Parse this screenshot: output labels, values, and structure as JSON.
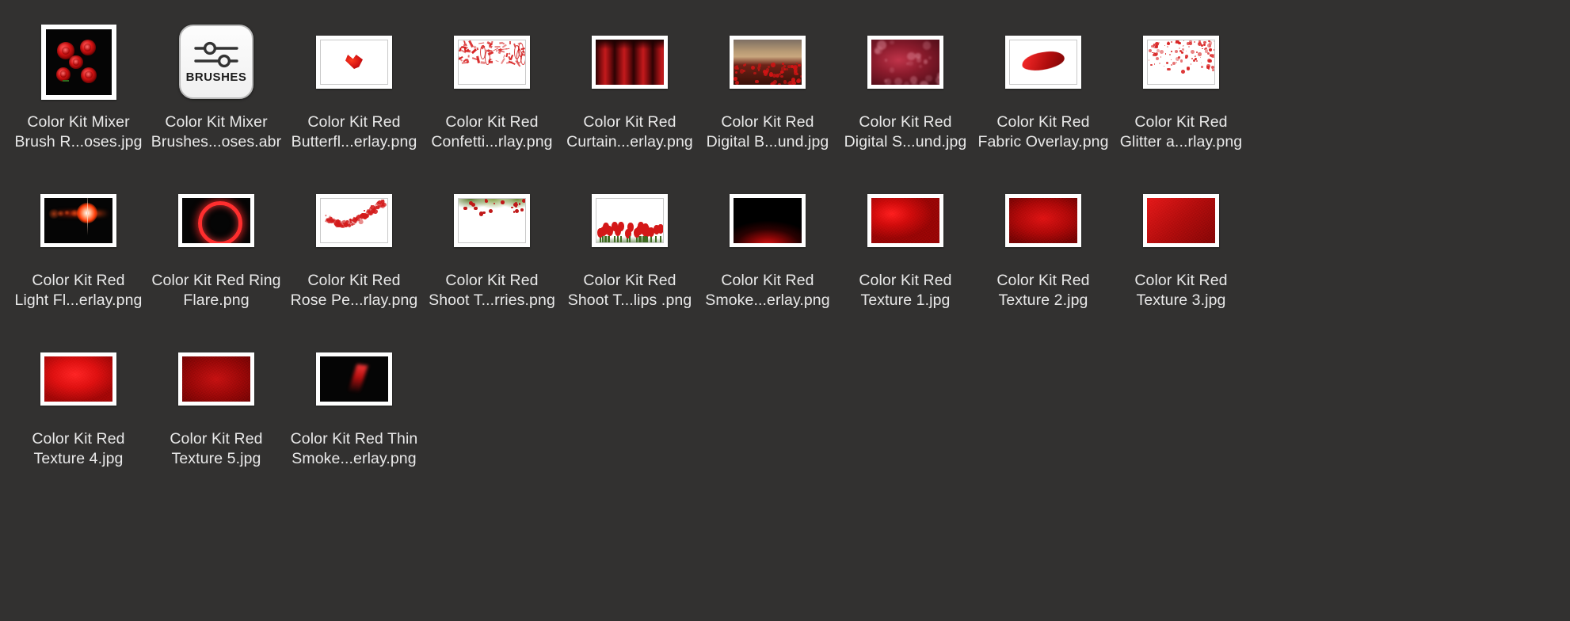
{
  "window": {
    "view": "icon-view",
    "background_color": "#323130",
    "label_color": "#e9e9e9",
    "columns": 9,
    "rows": 3
  },
  "files": [
    {
      "id": "color-kit-mixer-brush-roses-jpg",
      "line1": "Color Kit Mixer",
      "line2": "Brush R...oses.jpg",
      "kind": "image",
      "thumb": "roses-on-black",
      "shape": "square"
    },
    {
      "id": "color-kit-mixer-brushes-roses-abr",
      "line1": "Color Kit Mixer",
      "line2": "Brushes...oses.abr",
      "kind": "brush-file",
      "thumb": "app-icon-brushes",
      "icon_caption": "BRUSHES",
      "shape": "app"
    },
    {
      "id": "color-kit-red-butterfly-overlay-png",
      "line1": "Color Kit Red",
      "line2": "Butterfl...erlay.png",
      "kind": "image",
      "thumb": "butterfly-on-white",
      "shape": "landscape"
    },
    {
      "id": "color-kit-red-confetti-overlay-png",
      "line1": "Color Kit Red",
      "line2": "Confetti...rlay.png",
      "kind": "image",
      "thumb": "confetti-on-white",
      "shape": "landscape"
    },
    {
      "id": "color-kit-red-curtain-overlay-png",
      "line1": "Color Kit Red",
      "line2": "Curtain...erlay.png",
      "kind": "image",
      "thumb": "red-curtain",
      "shape": "landscape"
    },
    {
      "id": "color-kit-red-digital-background-jpg",
      "line1": "Color Kit Red",
      "line2": "Digital B...und.jpg",
      "kind": "image",
      "thumb": "poppy-field",
      "shape": "landscape"
    },
    {
      "id": "color-kit-red-digital-s-background-jpg",
      "line1": "Color Kit Red",
      "line2": "Digital S...und.jpg",
      "kind": "image",
      "thumb": "red-floral-digital",
      "shape": "landscape"
    },
    {
      "id": "color-kit-red-fabric-overlay-png",
      "line1": "Color Kit Red",
      "line2": "Fabric Overlay.png",
      "kind": "image",
      "thumb": "red-fabric-swoosh",
      "shape": "landscape"
    },
    {
      "id": "color-kit-red-glitter-overlay-png",
      "line1": "Color Kit Red",
      "line2": "Glitter a...rlay.png",
      "kind": "image",
      "thumb": "glitter-hearts",
      "shape": "landscape"
    },
    {
      "id": "color-kit-red-light-flare-overlay-png",
      "line1": "Color Kit Red",
      "line2": "Light Fl...erlay.png",
      "kind": "image",
      "thumb": "lens-flare",
      "shape": "landscape"
    },
    {
      "id": "color-kit-red-ring-flare-png",
      "line1": "Color Kit Red Ring",
      "line2": "Flare.png",
      "kind": "image",
      "thumb": "ring-flare",
      "shape": "landscape"
    },
    {
      "id": "color-kit-red-rose-petal-overlay-png",
      "line1": "Color Kit Red",
      "line2": "Rose Pe...rlay.png",
      "kind": "image",
      "thumb": "rose-petals",
      "shape": "landscape"
    },
    {
      "id": "color-kit-red-shoot-through-berries-png",
      "line1": "Color Kit Red",
      "line2": "Shoot T...rries.png",
      "kind": "image",
      "thumb": "shoot-through-berries",
      "shape": "landscape"
    },
    {
      "id": "color-kit-red-shoot-through-tulips-png",
      "line1": "Color Kit Red",
      "line2": "Shoot T...lips .png",
      "kind": "image",
      "thumb": "shoot-through-tulips",
      "shape": "landscape"
    },
    {
      "id": "color-kit-red-smoke-overlay-png",
      "line1": "Color Kit Red",
      "line2": "Smoke...erlay.png",
      "kind": "image",
      "thumb": "red-smoke",
      "shape": "landscape"
    },
    {
      "id": "color-kit-red-texture-1-jpg",
      "line1": "Color Kit Red",
      "line2": "Texture 1.jpg",
      "kind": "image",
      "thumb": "texture-1",
      "shape": "landscape"
    },
    {
      "id": "color-kit-red-texture-2-jpg",
      "line1": "Color Kit Red",
      "line2": "Texture 2.jpg",
      "kind": "image",
      "thumb": "texture-2",
      "shape": "landscape"
    },
    {
      "id": "color-kit-red-texture-3-jpg",
      "line1": "Color Kit Red",
      "line2": "Texture 3.jpg",
      "kind": "image",
      "thumb": "texture-3",
      "shape": "landscape"
    },
    {
      "id": "color-kit-red-texture-4-jpg",
      "line1": "Color Kit Red",
      "line2": "Texture 4.jpg",
      "kind": "image",
      "thumb": "texture-4",
      "shape": "landscape"
    },
    {
      "id": "color-kit-red-texture-5-jpg",
      "line1": "Color Kit Red",
      "line2": "Texture 5.jpg",
      "kind": "image",
      "thumb": "texture-5",
      "shape": "landscape"
    },
    {
      "id": "color-kit-red-thin-smoke-overlay-png",
      "line1": "Color Kit Red Thin",
      "line2": "Smoke...erlay.png",
      "kind": "image",
      "thumb": "thin-red-smoke",
      "shape": "landscape"
    }
  ]
}
